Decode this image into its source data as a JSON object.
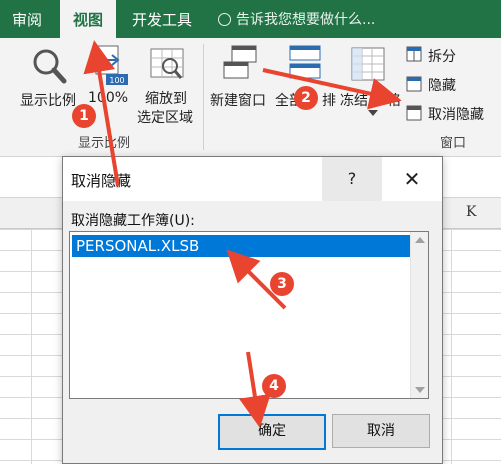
{
  "tabs": [
    {
      "label": "审阅",
      "active": false
    },
    {
      "label": "视图",
      "active": true
    },
    {
      "label": "开发工具",
      "active": false
    }
  ],
  "tell_me": "告诉我您想要做什么...",
  "ribbon": {
    "zoom_button": "显示比例",
    "zoom_100": "100%",
    "zoom_selection_line1": "缩放到",
    "zoom_selection_line2": "选定区域",
    "zoom_group_label": "显示比例",
    "new_window": "新建窗口",
    "arrange_all_partial": "全部",
    "arrange_all_tail": "排",
    "freeze_partial": "冻结",
    "freeze_tail": "格",
    "split": "拆分",
    "hide": "隐藏",
    "unhide": "取消隐藏",
    "window_group_label": "窗口"
  },
  "sheet": {
    "column_k": "K"
  },
  "dialog": {
    "title": "取消隐藏",
    "help": "?",
    "close": "✕",
    "label": "取消隐藏工作簿(U):",
    "items": [
      "PERSONAL.XLSB"
    ],
    "ok": "确定",
    "cancel": "取消"
  },
  "callouts": [
    "1",
    "2",
    "3",
    "4"
  ],
  "colors": {
    "excel_green": "#217346",
    "arrow_red": "#e8442f",
    "selection_blue": "#0078d7"
  }
}
